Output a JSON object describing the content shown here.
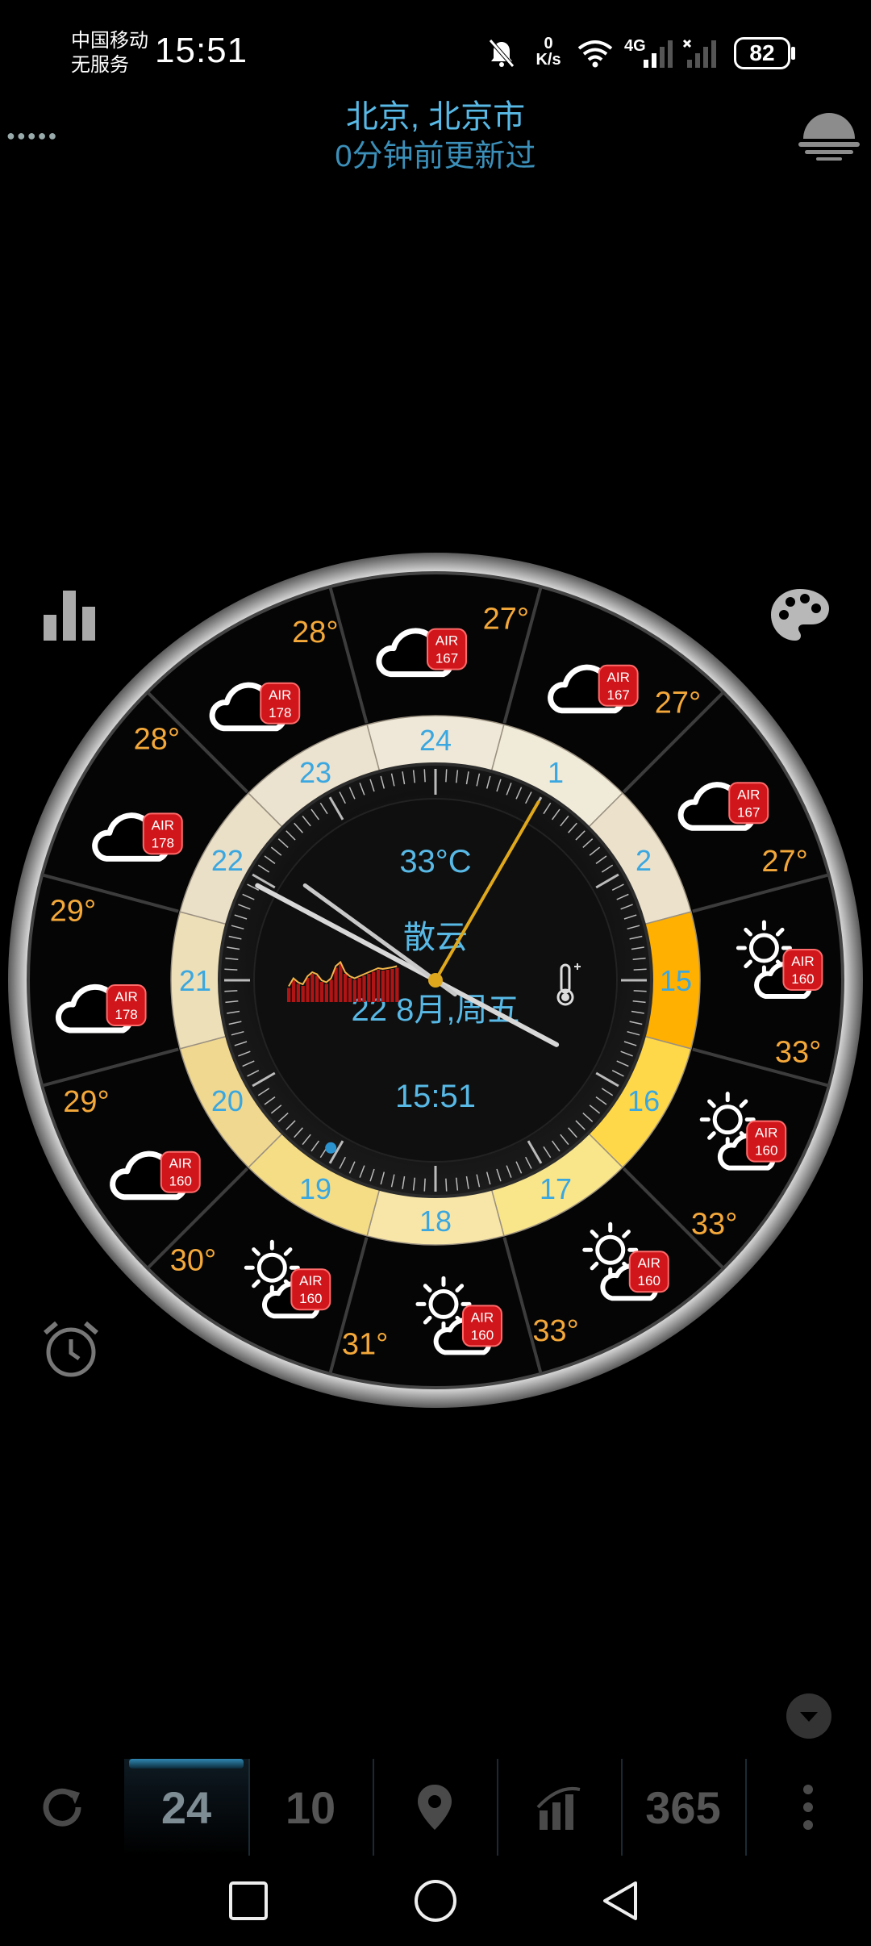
{
  "status_bar": {
    "carrier_line1": "中国移动",
    "carrier_line2": "无服务",
    "time": "15:51",
    "net_speed_value": "0",
    "net_speed_unit": "K/s",
    "network_label": "4G",
    "battery": "82"
  },
  "header": {
    "location": "北京, 北京市",
    "updated": "0分钟前更新过"
  },
  "dial": {
    "current_temp": "33°C",
    "condition": "散云",
    "date": "22 8月,周五",
    "time": "15:51",
    "hour_labels": [
      "24",
      "1",
      "2",
      "15",
      "16",
      "17",
      "18",
      "19",
      "20",
      "21",
      "22",
      "23"
    ],
    "hour_angles": [
      0,
      30,
      60,
      90,
      120,
      150,
      180,
      210,
      240,
      270,
      300,
      330
    ],
    "forecast": [
      {
        "temp": "27°",
        "air": "167",
        "icon": "cloud-icon"
      },
      {
        "temp": "27°",
        "air": "167",
        "icon": "cloud-icon"
      },
      {
        "temp": "27°",
        "air": "167",
        "icon": "cloud-icon"
      },
      {
        "temp": "33°",
        "air": "160",
        "icon": "sun-cloud-icon"
      },
      {
        "temp": "33°",
        "air": "160",
        "icon": "sun-cloud-icon"
      },
      {
        "temp": "33°",
        "air": "160",
        "icon": "sun-cloud-icon"
      },
      {
        "temp": "31°",
        "air": "160",
        "icon": "sun-cloud-icon"
      },
      {
        "temp": "30°",
        "air": "160",
        "icon": "sun-cloud-icon"
      },
      {
        "temp": "29°",
        "air": "160",
        "icon": "cloud-icon"
      },
      {
        "temp": "29°",
        "air": "178",
        "icon": "cloud-icon"
      },
      {
        "temp": "28°",
        "air": "178",
        "icon": "cloud-icon"
      },
      {
        "temp": "28°",
        "air": "178",
        "icon": "cloud-icon"
      }
    ],
    "air_label": "AIR",
    "hour_hand_angle": 298,
    "minute_hand_angle": 306,
    "second_hand_angle": 30,
    "sparkline": [
      0.35,
      0.55,
      0.45,
      0.4,
      0.6,
      0.7,
      0.65,
      0.5,
      0.45,
      0.55,
      0.85,
      0.95,
      0.7,
      0.6,
      0.55,
      0.6,
      0.65,
      0.7,
      0.75,
      0.8,
      0.78,
      0.8,
      0.82,
      0.85
    ]
  },
  "tabs": [
    {
      "label": "",
      "icon": "refresh-icon"
    },
    {
      "label": "24",
      "icon": ""
    },
    {
      "label": "10",
      "icon": ""
    },
    {
      "label": "",
      "icon": "location-pin-icon"
    },
    {
      "label": "",
      "icon": "bar-chart-icon"
    },
    {
      "label": "365",
      "icon": ""
    },
    {
      "label": "",
      "icon": "more-vertical-icon"
    }
  ],
  "colors": {
    "accent_blue": "#58b9e6",
    "temp_orange": "#f4a83a",
    "air_badge": "#d0161b"
  }
}
